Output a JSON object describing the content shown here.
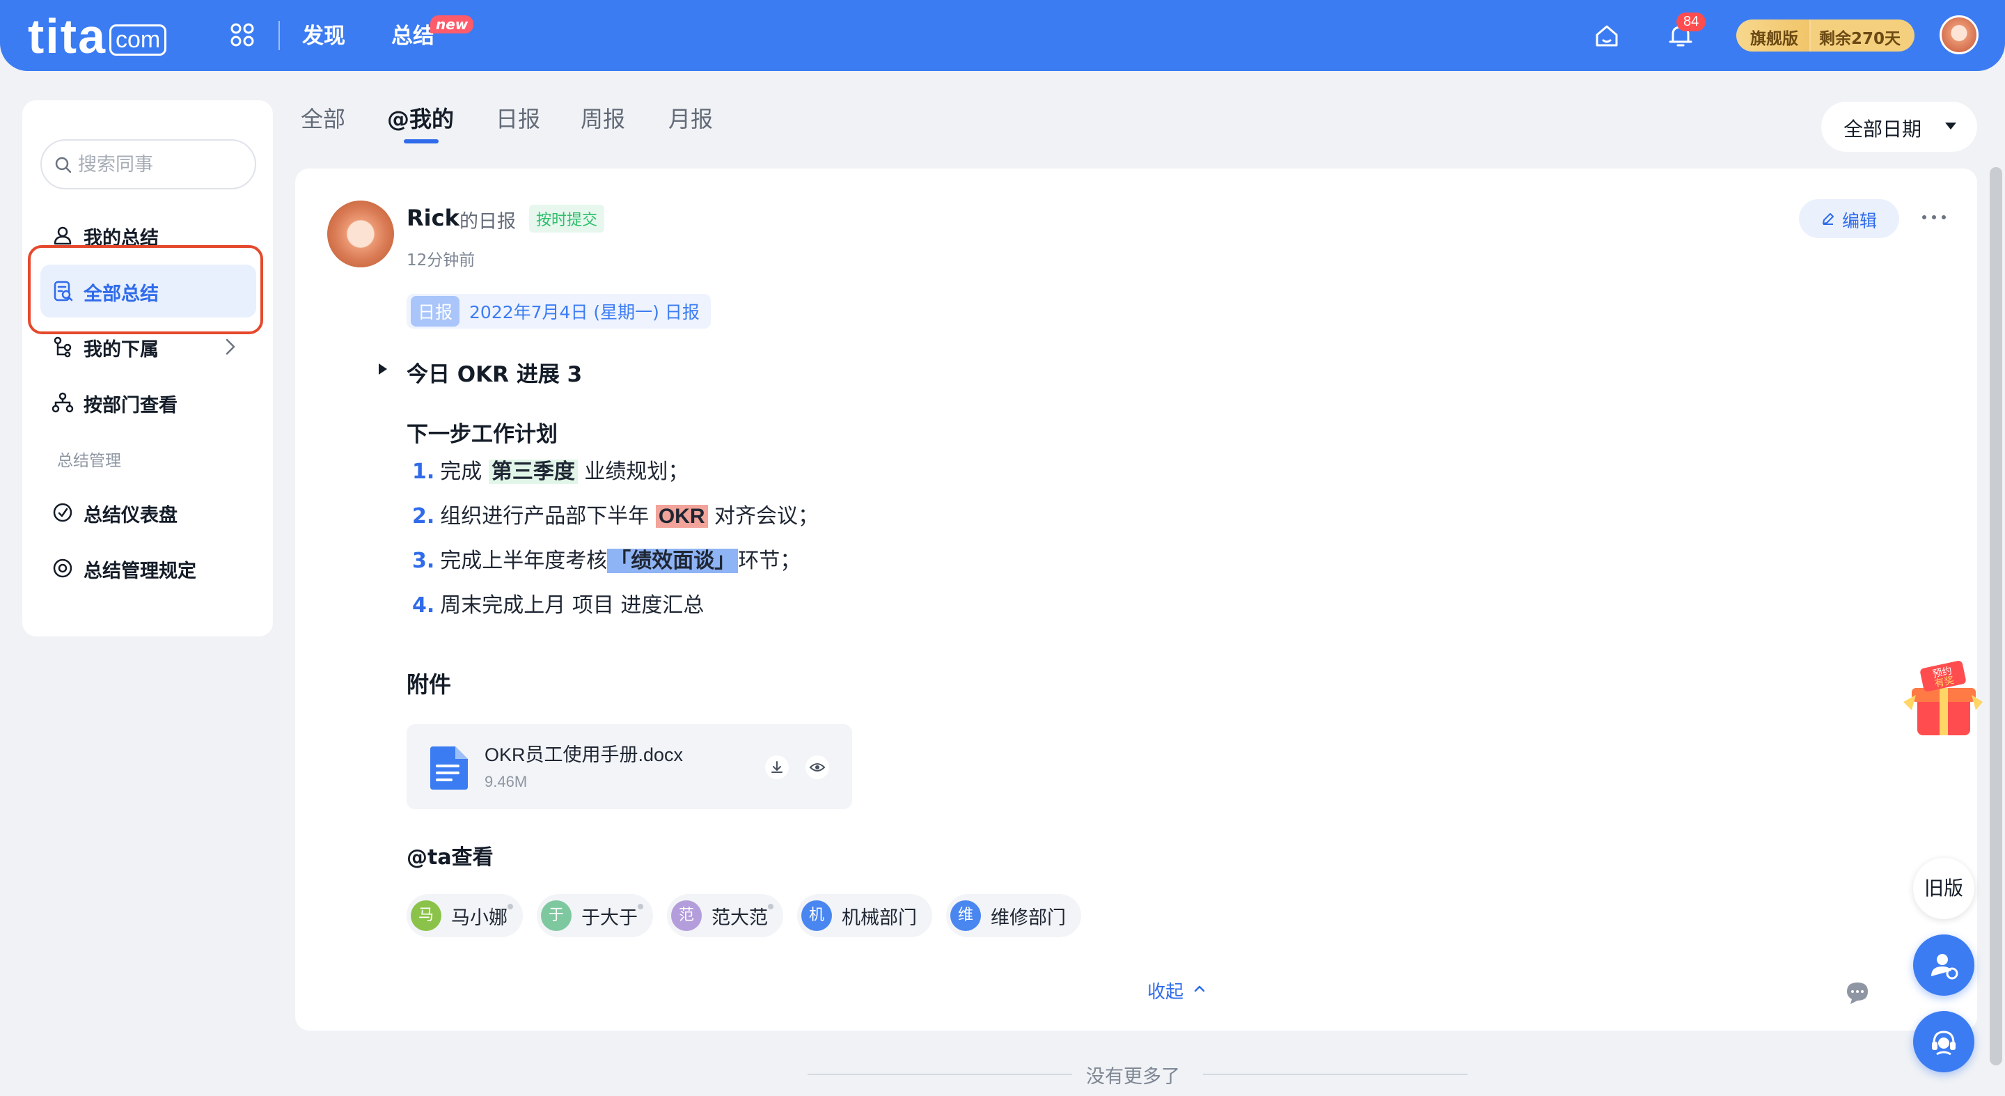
{
  "header": {
    "logo_main": "tita",
    "logo_domain": "com",
    "nav_discover": "发现",
    "nav_summary": "总结",
    "new_badge": "new",
    "notification_count": "84",
    "edition_label": "旗舰版",
    "edition_remaining": "剩余270天"
  },
  "sidebar": {
    "search_placeholder": "搜索同事",
    "items": [
      {
        "label": "我的总结",
        "icon": "user-icon"
      },
      {
        "label": "全部总结",
        "icon": "summary-search-icon",
        "active": true
      },
      {
        "label": "我的下属",
        "icon": "org-icon"
      },
      {
        "label": "按部门查看",
        "icon": "department-icon"
      }
    ],
    "section_title": "总结管理",
    "manage_items": [
      {
        "label": "总结仪表盘",
        "icon": "dashboard-icon"
      },
      {
        "label": "总结管理规定",
        "icon": "settings-icon"
      }
    ]
  },
  "tabs": [
    {
      "label": "全部"
    },
    {
      "label": "@我的",
      "active": true
    },
    {
      "label": "日报"
    },
    {
      "label": "周报"
    },
    {
      "label": "月报"
    }
  ],
  "date_filter": "全部日期",
  "report": {
    "author": "Rick",
    "author_suffix": "的日报",
    "status_tag": "按时提交",
    "time_ago": "12分钟前",
    "edit_label": "编辑",
    "type_tag": "日报",
    "date_label": "2022年7月4日 (星期一) 日报",
    "okr_progress": "今日 OKR 进展  3",
    "plan_title": "下一步工作计划",
    "plan_items": [
      {
        "num": "1.",
        "before": "完成 ",
        "highlight": "第三季度",
        "after": " 业绩规划；"
      },
      {
        "num": "2.",
        "before": "组织进行产品部下半年 ",
        "highlight": "OKR",
        "after": " 对齐会议；"
      },
      {
        "num": "3.",
        "before": "完成上半年度考核",
        "highlight": "「绩效面谈」",
        "after": "环节；"
      },
      {
        "num": "4.",
        "before": "周末完成上月 项目 进度汇总",
        "highlight": "",
        "after": ""
      }
    ],
    "attachments_title": "附件",
    "attachment": {
      "name": "OKR员工使用手册.docx",
      "size": "9.46M"
    },
    "mention_title": "@ta查看",
    "mentions": [
      {
        "initial": "马",
        "name": "马小娜",
        "color": "#8bc34a"
      },
      {
        "initial": "于",
        "name": "于大于",
        "color": "#7ec8a0"
      },
      {
        "initial": "范",
        "name": "范大范",
        "color": "#b39ddb"
      },
      {
        "initial": "机",
        "name": "机械部门",
        "color": "#4a86f0"
      },
      {
        "initial": "维",
        "name": "维修部门",
        "color": "#4a86f0"
      }
    ],
    "collapse_label": "收起"
  },
  "footer": {
    "end_text": "没有更多了"
  },
  "floating": {
    "promo_text": "预约有奖",
    "old_version": "旧版"
  },
  "colors": {
    "brand": "#3c7cf2",
    "active_bg": "#e8f0fe",
    "highlight_border": "#e5492d"
  }
}
